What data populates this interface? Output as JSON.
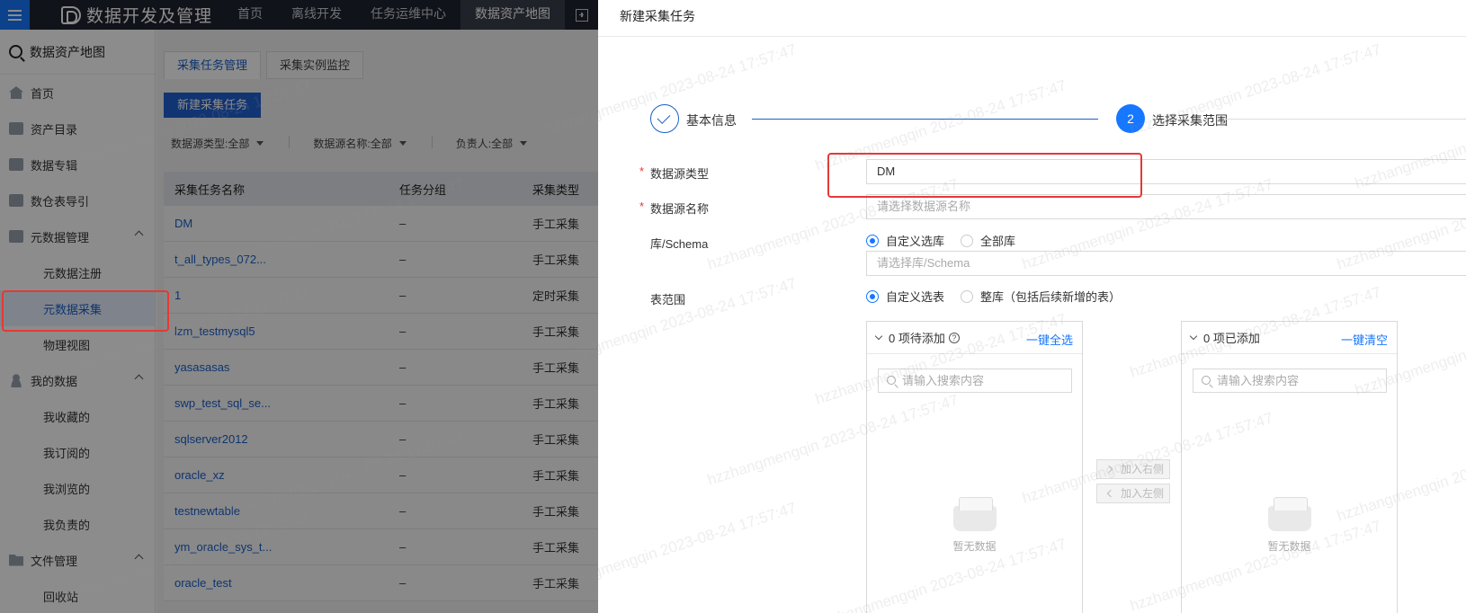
{
  "topbar": {
    "brand": "数据开发及管理",
    "nav": [
      "首页",
      "离线开发",
      "任务运维中心",
      "数据资产地图"
    ],
    "active_nav_index": 3
  },
  "sidebar": {
    "title": "数据资产地图",
    "items": [
      {
        "label": "首页",
        "icon": "home-icon"
      },
      {
        "label": "资产目录",
        "icon": "catalog-icon"
      },
      {
        "label": "数据专辑",
        "icon": "album-icon"
      },
      {
        "label": "数仓表导引",
        "icon": "warehouse-icon"
      },
      {
        "label": "元数据管理",
        "icon": "metadata-icon",
        "expanded": true
      },
      {
        "label": "元数据注册",
        "sub": true
      },
      {
        "label": "元数据采集",
        "sub": true,
        "active": true
      },
      {
        "label": "物理视图",
        "sub": true
      },
      {
        "label": "我的数据",
        "icon": "user-icon",
        "expanded": true
      },
      {
        "label": "我收藏的",
        "sub": true
      },
      {
        "label": "我订阅的",
        "sub": true
      },
      {
        "label": "我浏览的",
        "sub": true
      },
      {
        "label": "我负责的",
        "sub": true
      },
      {
        "label": "文件管理",
        "icon": "folder-icon",
        "expanded": true
      },
      {
        "label": "回收站",
        "sub": true
      }
    ]
  },
  "main": {
    "tabs": [
      "采集任务管理",
      "采集实例监控"
    ],
    "new_button": "新建采集任务",
    "filters": [
      {
        "label": "数据源类型: ",
        "value": "全部"
      },
      {
        "label": "数据源名称: ",
        "value": "全部"
      },
      {
        "label": "负责人: ",
        "value": "全部"
      }
    ],
    "columns": [
      "采集任务名称",
      "任务分组",
      "采集类型"
    ],
    "rows": [
      [
        "DM",
        "–",
        "手工采集"
      ],
      [
        "t_all_types_072...",
        "–",
        "手工采集"
      ],
      [
        "1",
        "–",
        "定时采集"
      ],
      [
        "lzm_testmysql5",
        "–",
        "手工采集"
      ],
      [
        "yasasasas",
        "–",
        "手工采集"
      ],
      [
        "swp_test_sql_se...",
        "–",
        "手工采集"
      ],
      [
        "sqlserver2012",
        "–",
        "手工采集"
      ],
      [
        "oracle_xz",
        "–",
        "手工采集"
      ],
      [
        "testnewtable",
        "–",
        "手工采集"
      ],
      [
        "ym_oracle_sys_t...",
        "–",
        "手工采集"
      ],
      [
        "oracle_test",
        "–",
        "手工采集"
      ]
    ]
  },
  "drawer": {
    "title": "新建采集任务",
    "steps": [
      {
        "label": "基本信息",
        "status": "done"
      },
      {
        "label": "选择采集范围",
        "number": "2",
        "status": "active"
      }
    ],
    "fields": {
      "source_type": {
        "label": "数据源类型",
        "value": "DM",
        "required": true
      },
      "source_name": {
        "label": "数据源名称",
        "placeholder": "请选择数据源名称",
        "required": true
      },
      "schema": {
        "label": "库/Schema",
        "options": [
          "自定义选库",
          "全部库"
        ],
        "selected": "自定义选库",
        "placeholder": "请选择库/Schema"
      },
      "table_scope": {
        "label": "表范围",
        "options": [
          "自定义选表",
          "整库（包括后续新增的表）"
        ],
        "selected": "自定义选表"
      }
    },
    "transfer": {
      "left": {
        "title": "0 项待添加",
        "action": "一键全选",
        "search_placeholder": "请输入搜索内容",
        "empty": "暂无数据"
      },
      "right": {
        "title": "0 项已添加",
        "action": "一键清空",
        "search_placeholder": "请输入搜索内容",
        "empty": "暂无数据"
      },
      "to_right": "加入右侧",
      "to_left": "加入左侧"
    }
  },
  "watermark": "hzzhangmengqin 2023-08-24 17:57:47",
  "colors": {
    "accent": "#1677ff",
    "highlight": "#e53935",
    "topbar": "#1f2430"
  }
}
